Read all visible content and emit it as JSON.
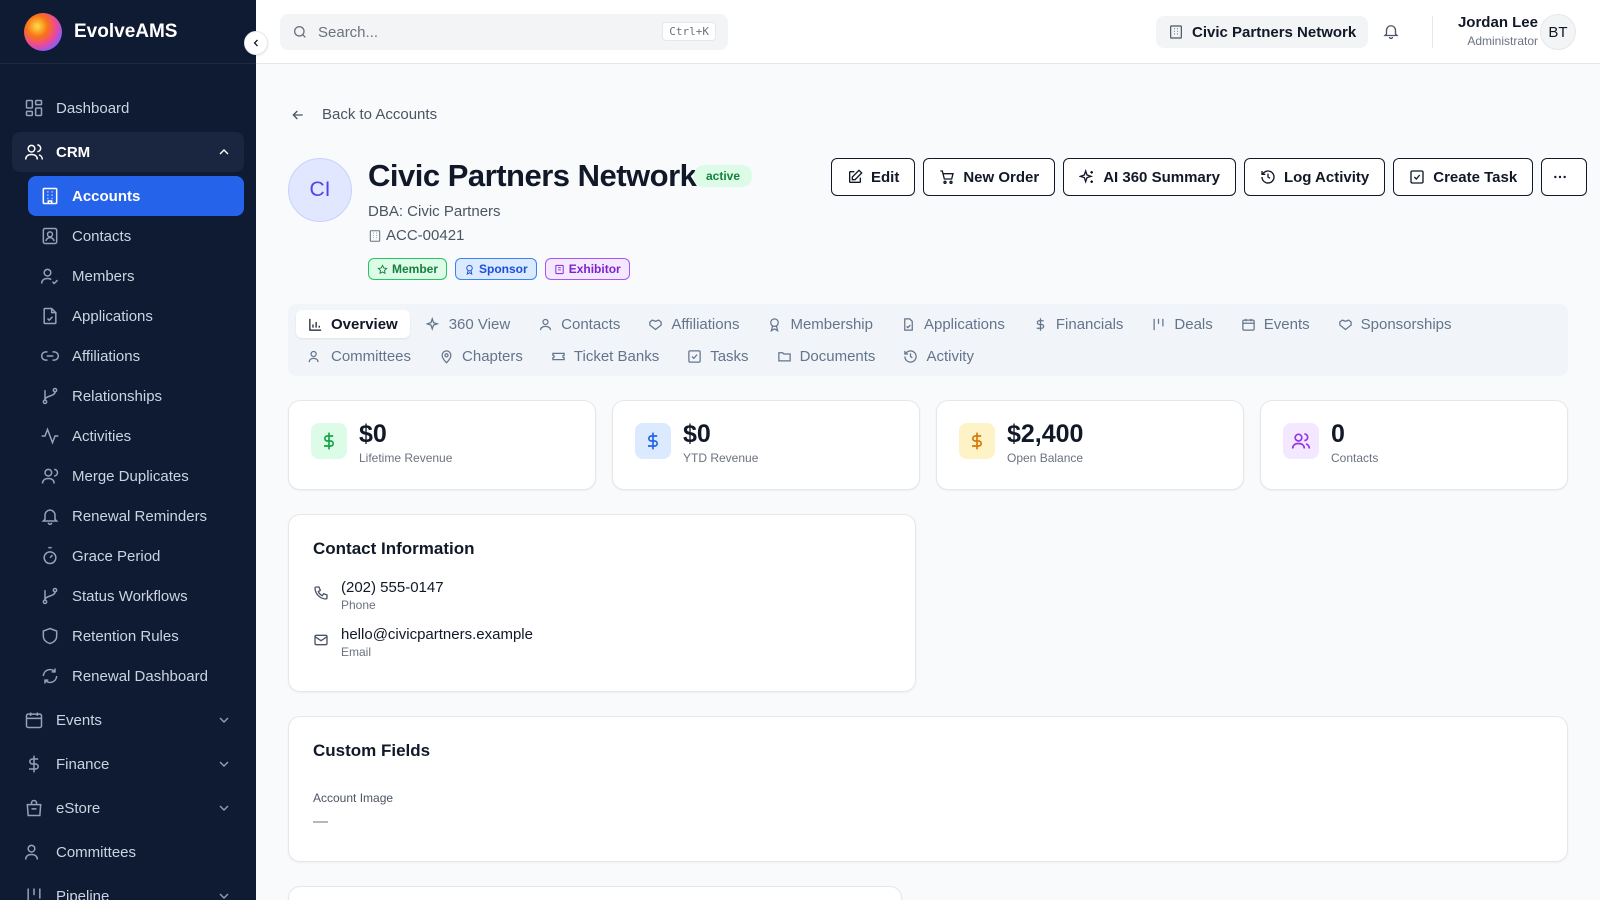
{
  "app": {
    "name": "EvolveAMS"
  },
  "sidebar": {
    "items": [
      {
        "label": "Dashboard",
        "icon": "dashboard-icon"
      },
      {
        "label": "CRM",
        "icon": "users-icon"
      }
    ],
    "crm_sub": [
      {
        "label": "Accounts",
        "icon": "building-icon",
        "active": true
      },
      {
        "label": "Contacts",
        "icon": "contact-icon"
      },
      {
        "label": "Members",
        "icon": "user-check-icon"
      },
      {
        "label": "Applications",
        "icon": "file-icon"
      },
      {
        "label": "Affiliations",
        "icon": "link-icon"
      },
      {
        "label": "Relationships",
        "icon": "branch-icon"
      },
      {
        "label": "Activities",
        "icon": "activity-icon"
      },
      {
        "label": "Merge Duplicates",
        "icon": "user-icon"
      },
      {
        "label": "Renewal Reminders",
        "icon": "bell-icon"
      },
      {
        "label": "Grace Period",
        "icon": "timer-icon"
      },
      {
        "label": "Status Workflows",
        "icon": "branch-icon"
      },
      {
        "label": "Retention Rules",
        "icon": "shield-icon"
      },
      {
        "label": "Renewal Dashboard",
        "icon": "refresh-icon"
      }
    ],
    "groups": [
      {
        "label": "Events",
        "icon": "calendar-icon"
      },
      {
        "label": "Finance",
        "icon": "dollar-icon"
      },
      {
        "label": "eStore",
        "icon": "store-icon"
      },
      {
        "label": "Committees",
        "icon": "users-icon"
      },
      {
        "label": "Pipeline",
        "icon": "kanban-icon"
      }
    ]
  },
  "topbar": {
    "search_placeholder": "Search...",
    "shortcut": "Ctrl+K",
    "org": "Civic Partners Network",
    "user_name": "Jordan Lee",
    "user_role": "Administrator",
    "user_initials": "BT"
  },
  "account": {
    "back_label": "Back to Accounts",
    "initials": "CI",
    "name": "Civic Partners Network",
    "status": "active",
    "dba": "DBA: Civic Partners",
    "number": "ACC-00421",
    "tags": [
      "Member",
      "Sponsor",
      "Exhibitor"
    ]
  },
  "actions": [
    "Edit",
    "New Order",
    "AI 360 Summary",
    "Log Activity",
    "Create Task"
  ],
  "tabs_row1": [
    "Overview",
    "360 View",
    "Contacts",
    "Affiliations",
    "Membership",
    "Applications",
    "Financials",
    "Deals",
    "Events",
    "Sponsorships"
  ],
  "tabs_row2": [
    "Committees",
    "Chapters",
    "Ticket Banks",
    "Tasks",
    "Documents",
    "Activity"
  ],
  "stats": [
    {
      "value": "$0",
      "label": "Lifetime Revenue",
      "bg": "#dcfce7",
      "fg": "#16a34a"
    },
    {
      "value": "$0",
      "label": "YTD Revenue",
      "bg": "#dbeafe",
      "fg": "#2563eb"
    },
    {
      "value": "$2,400",
      "label": "Open Balance",
      "bg": "#fef3c7",
      "fg": "#d97706"
    },
    {
      "value": "0",
      "label": "Contacts",
      "bg": "#f3e8ff",
      "fg": "#9333ea"
    }
  ],
  "contact_info": {
    "title": "Contact Information",
    "phone": "(202) 555-0147",
    "phone_label": "Phone",
    "email": "hello@civicpartners.example",
    "email_label": "Email"
  },
  "custom_fields": {
    "title": "Custom Fields",
    "field_label": "Account Image",
    "field_value": "—"
  }
}
